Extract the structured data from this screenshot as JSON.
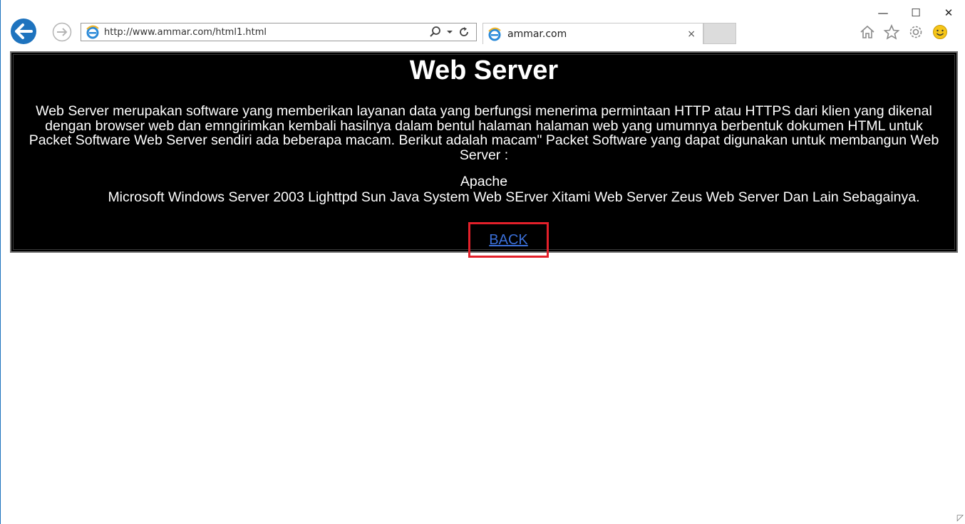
{
  "browser": {
    "address": {
      "url": "http://www.ammar.com/html1.html"
    },
    "tab": {
      "title": "ammar.com",
      "close": "×"
    },
    "window_controls": {
      "minimize": "—",
      "maximize": "☐",
      "close": "✕"
    },
    "icons": [
      "back-arrow-icon",
      "forward-arrow-icon",
      "ie-logo-icon",
      "search-icon",
      "dropdown-icon",
      "refresh-icon",
      "home-icon",
      "favorites-star-icon",
      "settings-gear-icon",
      "feedback-smiley-icon"
    ]
  },
  "page": {
    "heading": "Web Server",
    "paragraph": "Web Server merupakan software yang memberikan layanan data yang berfungsi menerima permintaan HTTP atau HTTPS dari klien yang dikenal dengan browser web dan emngirimkan kembali hasilnya dalam bentul halaman halaman web yang umumnya berbentuk dokumen HTML untuk Packet Software Web Server sendiri ada beberapa macam. Berikut adalah macam\" Packet Software yang dapat digunakan untuk membangun Web Server :",
    "software_first": "Apache",
    "software_rest": "Microsoft Windows Server 2003 Lighttpd Sun Java System Web SErver Xitami Web Server Zeus Web Server Dan Lain Sebagainya.",
    "back_link": "BACK"
  },
  "colors": {
    "content_bg": "#000000",
    "content_text": "#ffffff",
    "link": "#3a6fd8",
    "highlight_box": "#e3202a",
    "back_button": "#1e73be"
  }
}
